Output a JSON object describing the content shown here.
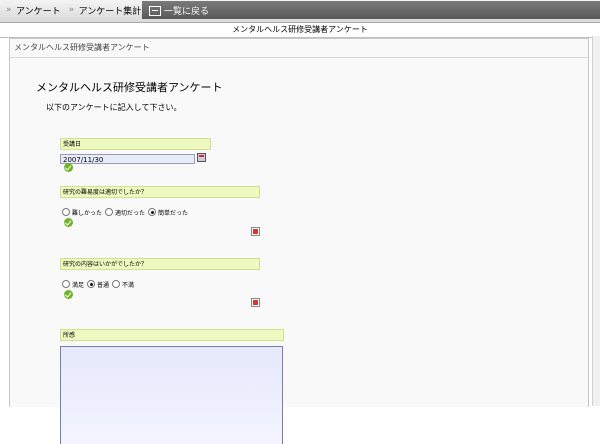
{
  "nav": {
    "breadcrumb": [
      "アンケート",
      "アンケート集計"
    ],
    "back_label": "一覧に戻る"
  },
  "form": {
    "bar_title": "メンタルヘルス研修受講者アンケート",
    "panel_header": "メンタルヘルス研修受講者アンケート",
    "title": "メンタルヘルス研修受講者アンケート",
    "instruction": "以下のアンケートに記入して下さい。"
  },
  "questions": {
    "q1": {
      "label": "受講日",
      "value": "2007/11/30"
    },
    "q2": {
      "label": "研究の難易度は適切でしたか？",
      "options": [
        "難しかった",
        "適切だった",
        "簡単だった"
      ],
      "selected": 2
    },
    "q3": {
      "label": "研究の内容はいかがでしたか？",
      "options": [
        "満足",
        "普通",
        "不満"
      ],
      "selected": 1
    },
    "q4": {
      "label": "所感",
      "value": ""
    }
  },
  "icons": {
    "chevron": "chevron-right-icon",
    "back": "list-back-icon",
    "calendar": "calendar-icon",
    "check": "check-icon",
    "clear": "clear-icon"
  },
  "colors": {
    "label_bg": "#eef8c1",
    "input_bg": "#e7ecfb",
    "check_green": "#6fb329",
    "back_tab": "#666666"
  }
}
